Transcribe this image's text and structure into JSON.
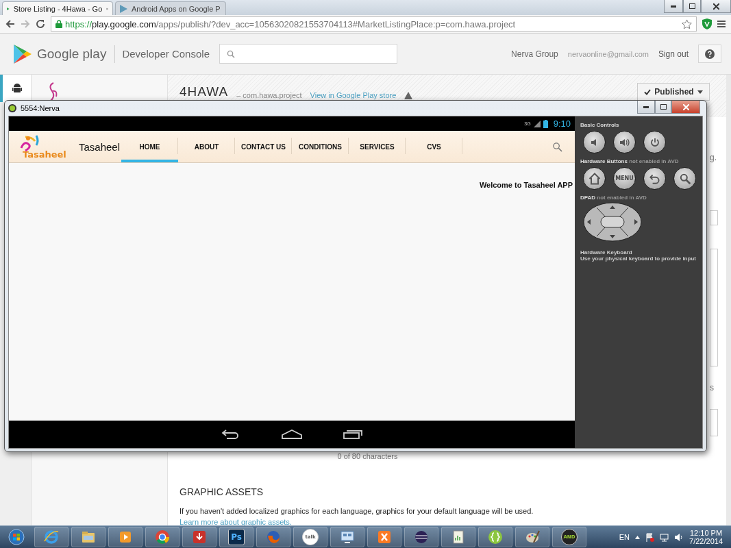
{
  "browser": {
    "tabs": [
      {
        "title": "Store Listing - 4Hawa - Go",
        "selected": true,
        "closable": true
      },
      {
        "title": "Android Apps on Google P",
        "selected": false,
        "closable": false
      }
    ],
    "url": {
      "scheme": "https://",
      "host": "play.google.com",
      "path": "/apps/publish/?dev_acc=10563020821553704113#MarketListingPlace:p=com.hawa.project"
    }
  },
  "console_header": {
    "brand": "Google play",
    "product": "Developer Console",
    "account": "Nerva Group",
    "email": "nervaonline@gmail.com",
    "sign_out": "Sign out"
  },
  "app_header": {
    "name": "4HAWA",
    "package": "– com.hawa.project",
    "store_link": "View in Google Play store",
    "status": "Published"
  },
  "listing": {
    "fragments": [
      "g.",
      "s"
    ],
    "counter": "0 of 80 characters",
    "section_title": "GRAPHIC ASSETS",
    "note": "If you haven't added localized graphics for each language, graphics for your default language will be used.",
    "link": "Learn more about graphic assets."
  },
  "emulator": {
    "title": "5554:Nerva",
    "network": "3G",
    "clock": "9:10",
    "app": {
      "logo": "Tasaheel",
      "title": "Tasaheel",
      "welcome": "Welcome to Tasaheel APP",
      "tabs": [
        {
          "label": "HOME",
          "selected": true
        },
        {
          "label": "ABOUT",
          "selected": false
        },
        {
          "label": "CONTACT US",
          "selected": false
        },
        {
          "label": "CONDITIONS",
          "selected": false
        },
        {
          "label": "SERVICES",
          "selected": false
        },
        {
          "label": "CVS",
          "selected": false
        }
      ]
    },
    "controls": {
      "sections": [
        {
          "title": "Basic Controls",
          "buttons": [
            {
              "kind": "volume-down"
            },
            {
              "kind": "volume-up"
            },
            {
              "kind": "power"
            }
          ]
        },
        {
          "title": "Hardware Buttons",
          "note": "not enabled in AVD",
          "buttons": [
            {
              "kind": "home"
            },
            {
              "kind": "menu",
              "label": "MENU"
            },
            {
              "kind": "back"
            },
            {
              "kind": "search"
            }
          ]
        },
        {
          "title": "DPAD",
          "note": "not enabled in AVD",
          "buttons": [
            {
              "kind": "dpad"
            }
          ]
        }
      ],
      "keyboard": {
        "title": "Hardware Keyboard",
        "hint": "Use your physical keyboard to provide input"
      }
    }
  },
  "taskbar": {
    "apps": [
      {
        "kind": "start"
      },
      {
        "kind": "ie"
      },
      {
        "kind": "folder"
      },
      {
        "kind": "media"
      },
      {
        "kind": "chrome"
      },
      {
        "kind": "download"
      },
      {
        "kind": "photoshop",
        "label": "Ps"
      },
      {
        "kind": "firefox"
      },
      {
        "kind": "talk",
        "label": "talk"
      },
      {
        "kind": "remote"
      },
      {
        "kind": "xampp"
      },
      {
        "kind": "eclipse"
      },
      {
        "kind": "notepad"
      },
      {
        "kind": "braces"
      },
      {
        "kind": "paint"
      },
      {
        "kind": "android",
        "label": "AND"
      }
    ],
    "language": "EN",
    "time": "12:10 PM",
    "date": "7/22/2014"
  }
}
